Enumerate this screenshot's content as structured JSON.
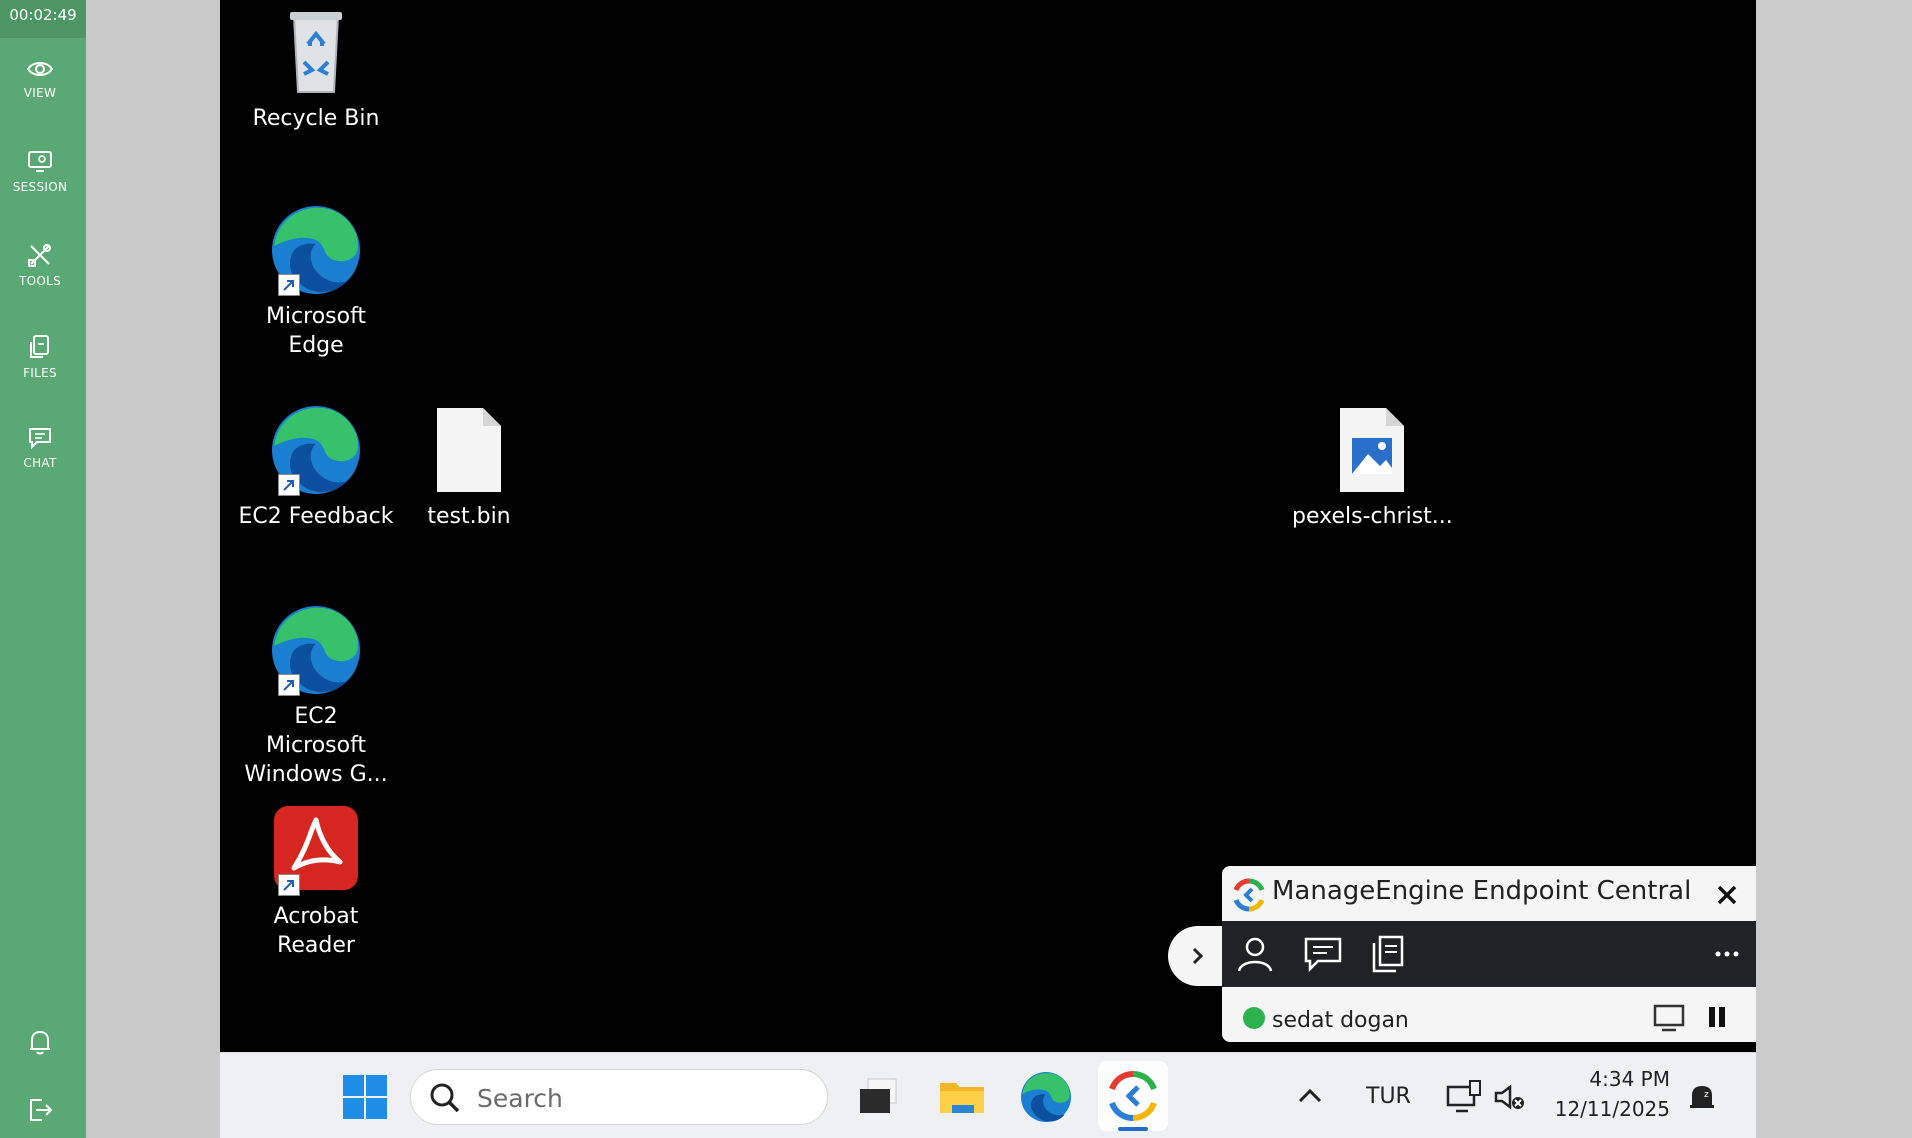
{
  "session": {
    "elapsed_time": "00:02:49"
  },
  "sidebar": {
    "items": [
      {
        "label": "VIEW",
        "icon": "eye-icon"
      },
      {
        "label": "SESSION",
        "icon": "monitor-icon"
      },
      {
        "label": "TOOLS",
        "icon": "tools-icon"
      },
      {
        "label": "FILES",
        "icon": "files-icon"
      },
      {
        "label": "CHAT",
        "icon": "chat-icon"
      }
    ],
    "bottom": [
      {
        "icon": "bell-icon"
      },
      {
        "icon": "exit-icon"
      }
    ]
  },
  "desktop": {
    "icons": [
      {
        "label": "Recycle Bin",
        "icon": "recycle-bin-icon"
      },
      {
        "label": "Microsoft Edge",
        "icon": "edge-icon",
        "shortcut": true
      },
      {
        "label": "EC2 Feedback",
        "icon": "edge-icon",
        "shortcut": true
      },
      {
        "label": "test.bin",
        "icon": "file-icon"
      },
      {
        "label": "pexels-christ...",
        "icon": "image-file-icon"
      },
      {
        "label": "EC2 Microsoft Windows G...",
        "icon": "edge-icon",
        "shortcut": true
      },
      {
        "label": "Acrobat Reader",
        "icon": "acrobat-icon",
        "shortcut": true
      }
    ]
  },
  "taskbar": {
    "search_placeholder": "Search",
    "language": "TUR",
    "time": "4:34 PM",
    "date": "12/11/2025",
    "apps": [
      "start-icon",
      "task-view-icon",
      "file-explorer-icon",
      "edge-icon",
      "manageengine-icon"
    ]
  },
  "manageengine_panel": {
    "title": "ManageEngine Endpoint Central",
    "user_name": "sedat dogan",
    "status_color": "#2bb24c",
    "toolbar_icons": [
      "user-icon",
      "chat-icon",
      "copy-icon",
      "more-icon"
    ]
  },
  "colors": {
    "sidebar": "#5aa873",
    "sidebar_timer": "#4b9663",
    "desktop": "#000000",
    "taskbar": "#eef0f3",
    "panel_toolbar": "#202226"
  }
}
